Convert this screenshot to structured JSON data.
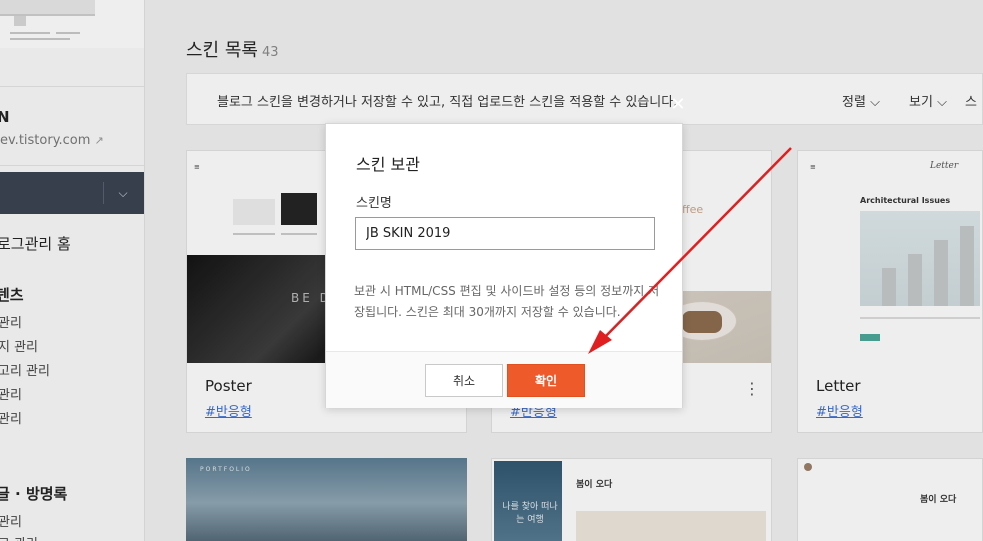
{
  "sidebar": {
    "blog_name": "N",
    "blog_url": "ev.tistory.com",
    "home_label": "로그관리 홈",
    "sections": [
      {
        "title": "텐츠",
        "items": [
          "관리",
          "지 관리",
          "고리 관리",
          "관리",
          "관리"
        ]
      },
      {
        "title": "글 · 방명록",
        "items": [
          "관리",
          "그 관리"
        ]
      }
    ],
    "dropdown_icon": "chevron-down-icon",
    "external_icon": "external-link-icon"
  },
  "main": {
    "title": "스킨 목록",
    "count": "43",
    "notice": "블로그 스킨을 변경하거나 저장할 수 있고, 직접 업로드한 스킨을 적용할 수 있습니다.",
    "sort_label": "정렬",
    "view_label": "보기",
    "extra_label": "스",
    "cards": [
      {
        "name": "Poster",
        "tag": "#반응형",
        "preview_text": "BE DI"
      },
      {
        "name": "",
        "tag": "#반응형",
        "preview_text": "ffee"
      },
      {
        "name": "Letter",
        "tag": "#반응형",
        "preview_logo": "Letter",
        "preview_title": "Architectural Issues"
      }
    ],
    "bottom_cards": [
      {
        "label": "PORTFOLIO"
      },
      {
        "phone_text": "나를 찾아 떠나는 여행",
        "heading": "봄이 오다"
      },
      {
        "heading": "봄이 오다"
      }
    ]
  },
  "modal": {
    "title": "스킨 보관",
    "field_label": "스킨명",
    "field_value": "JB SKIN 2019",
    "description": "보관 시 HTML/CSS 편집 및 사이드바 설정 등의 정보까지 저장됩니다. 스킨은 최대 30개까지 저장할 수 있습니다.",
    "cancel_label": "취소",
    "confirm_label": "확인",
    "close_icon": "close-icon",
    "confirm_color": "#ef5a2a"
  },
  "annotation": {
    "arrow_color": "#e02020"
  }
}
